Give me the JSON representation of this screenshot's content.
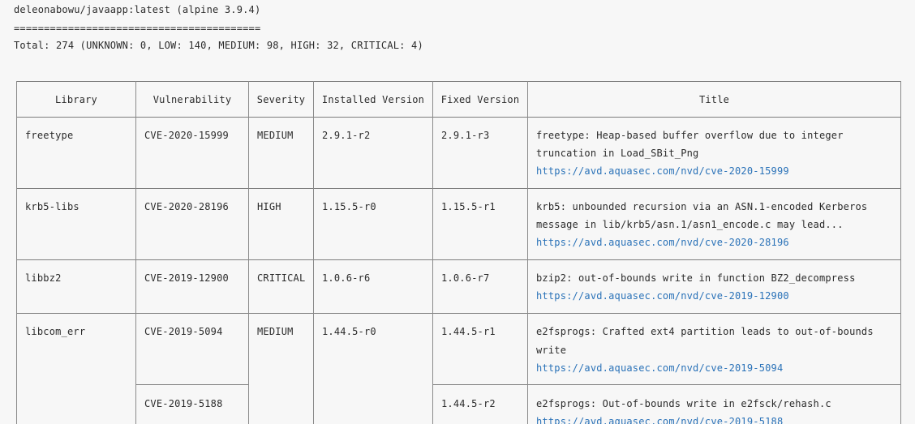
{
  "header": {
    "image_line": "deleonabowu/javaapp:latest (alpine 3.9.4)",
    "separator": "=========================================",
    "total_line": "Total: 274 (UNKNOWN: 0, LOW: 140, MEDIUM: 98, HIGH: 32, CRITICAL: 4)"
  },
  "table": {
    "columns": [
      "Library",
      "Vulnerability",
      "Severity",
      "Installed Version",
      "Fixed Version",
      "Title"
    ],
    "rows": [
      {
        "library": "freetype",
        "vulnerability": "CVE-2020-15999",
        "severity": "MEDIUM",
        "installed": "2.9.1-r2",
        "fixed": "2.9.1-r3",
        "title_lines": [
          "freetype: Heap-based buffer overflow due to integer",
          "truncation in Load_SBit_Png"
        ],
        "link": "https://avd.aquasec.com/nvd/cve-2020-15999"
      },
      {
        "library": "krb5-libs",
        "vulnerability": "CVE-2020-28196",
        "severity": "HIGH",
        "installed": "1.15.5-r0",
        "fixed": "1.15.5-r1",
        "title_lines": [
          "krb5: unbounded recursion via an ASN.1-encoded Kerberos",
          "message in lib/krb5/asn.1/asn1_encode.c may lead..."
        ],
        "link": "https://avd.aquasec.com/nvd/cve-2020-28196"
      },
      {
        "library": "libbz2",
        "vulnerability": "CVE-2019-12900",
        "severity": "CRITICAL",
        "installed": "1.0.6-r6",
        "fixed": "1.0.6-r7",
        "title_lines": [
          "bzip2: out-of-bounds write in function BZ2_decompress"
        ],
        "link": "https://avd.aquasec.com/nvd/cve-2019-12900"
      },
      {
        "library": "libcom_err",
        "vulnerability": "CVE-2019-5094",
        "severity": "MEDIUM",
        "installed": "1.44.5-r0",
        "fixed": "1.44.5-r1",
        "title_lines": [
          "e2fsprogs: Crafted ext4 partition leads to out-of-bounds",
          "write"
        ],
        "link": "https://avd.aquasec.com/nvd/cve-2019-5094"
      },
      {
        "library": "",
        "vulnerability": "CVE-2019-5188",
        "severity": "",
        "installed": "",
        "fixed": "1.44.5-r2",
        "title_lines": [
          "e2fsprogs: Out-of-bounds write in e2fsck/rehash.c"
        ],
        "link": "https://avd.aquasec.com/nvd/cve-2019-5188"
      }
    ]
  }
}
